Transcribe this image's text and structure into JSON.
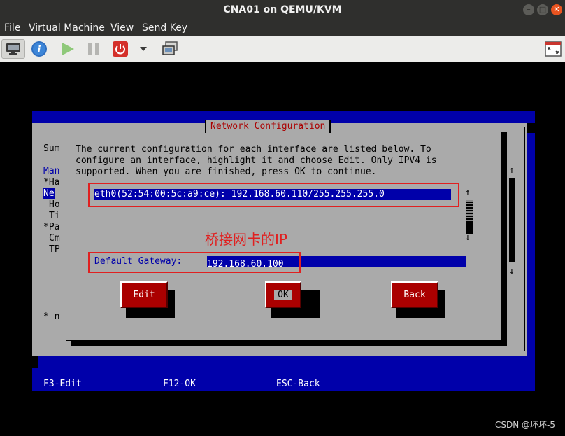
{
  "window": {
    "title": "CNA01 on QEMU/KVM",
    "controls": [
      "–",
      "□",
      "✕"
    ]
  },
  "menu": [
    "File",
    "Virtual Machine",
    "View",
    "Send Key"
  ],
  "toolbar": {
    "icons": [
      "monitor-icon",
      "info-icon",
      "play-icon",
      "pause-icon",
      "power-icon",
      "chevron-down-icon",
      "snapshot-icon",
      "fullscreen-icon"
    ]
  },
  "console": {
    "background": {
      "col_top": "Sum",
      "col_items": [
        "Man",
        "*Ha",
        "Ne",
        "Ho",
        "Ti",
        "*Pa",
        "Cm",
        "TP"
      ],
      "col_bottom": "* n",
      "arrow_up": "↑",
      "arrow_down": "↓"
    },
    "dialog": {
      "title": "Network Configuration",
      "description": [
        "The current configuration for each interface are listed below. To",
        "configure an interface, highlight it and choose Edit. Only IPV4 is",
        "supported. When you are finished, press OK to continue."
      ],
      "interface_entry": "eth0(52:54:00:5c:a9:ce): 192.168.60.110/255.255.255.0",
      "scroll_up": "↑",
      "scroll_down": "↓",
      "gateway_label": "Default Gateway:",
      "gateway_value": "192.168.60.100",
      "buttons": {
        "edit": "Edit",
        "ok": "OK",
        "back": "Back"
      }
    },
    "footer": {
      "f3": "F3-Edit",
      "f12": "F12-OK",
      "esc": "ESC-Back"
    },
    "annotation": "桥接网卡的IP"
  },
  "watermark": "CSDN @坏坏-5",
  "colors": {
    "tui_blue": "#0000aa",
    "tui_grey": "#aaaaaa",
    "tui_red": "#aa0000",
    "annotation_red": "#e02020"
  }
}
